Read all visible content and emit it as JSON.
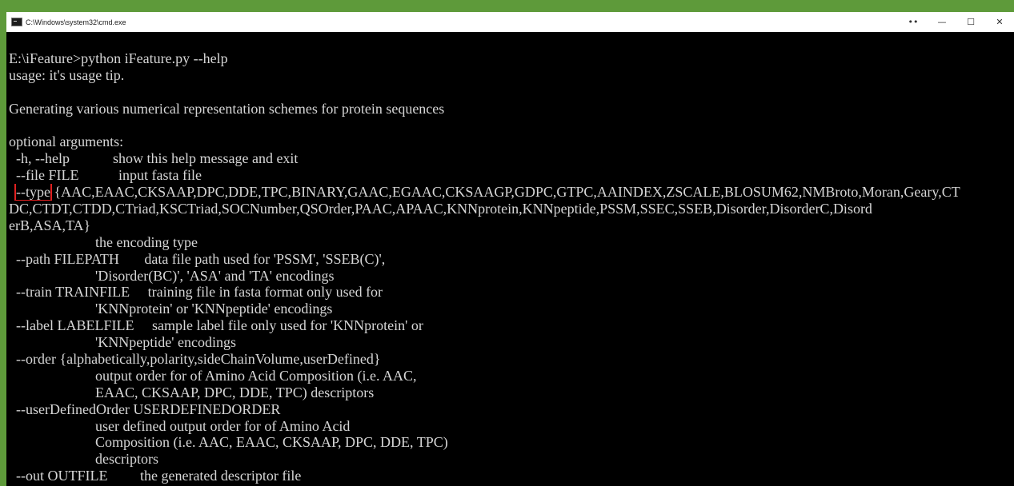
{
  "window": {
    "title": "C:\\Windows\\system32\\cmd.exe",
    "controls": {
      "extra": "••",
      "minimize": "—",
      "maximize": "☐",
      "close": "✕"
    }
  },
  "console": {
    "lines": [
      "E:\\iFeature>python iFeature.py --help",
      "usage: it's usage tip.",
      "",
      "Generating various numerical representation schemes for protein sequences",
      "",
      "optional arguments:",
      "  -h, --help            show this help message and exit",
      "  --file FILE           input fasta file",
      "__TYPE_LINE__",
      "DC,CTDT,CTDD,CTriad,KSCTriad,SOCNumber,QSOrder,PAAC,APAAC,KNNprotein,KNNpeptide,PSSM,SSEC,SSEB,Disorder,DisorderC,Disord",
      "erB,ASA,TA}",
      "                        the encoding type",
      "  --path FILEPATH       data file path used for 'PSSM', 'SSEB(C)',",
      "                        'Disorder(BC)', 'ASA' and 'TA' encodings",
      "  --train TRAINFILE     training file in fasta format only used for",
      "                        'KNNprotein' or 'KNNpeptide' encodings",
      "  --label LABELFILE     sample label file only used for 'KNNprotein' or",
      "                        'KNNpeptide' encodings",
      "  --order {alphabetically,polarity,sideChainVolume,userDefined}",
      "                        output order for of Amino Acid Composition (i.e. AAC,",
      "                        EAAC, CKSAAP, DPC, DDE, TPC) descriptors",
      "  --userDefinedOrder USERDEFINEDORDER",
      "                        user defined output order for of Amino Acid",
      "                        Composition (i.e. AAC, EAAC, CKSAAP, DPC, DDE, TPC)",
      "                        descriptors",
      "  --out OUTFILE         the generated descriptor file"
    ],
    "type_line": {
      "indent": "  ",
      "flag": "--type",
      "rest": " {AAC,EAAC,CKSAAP,DPC,DDE,TPC,BINARY,GAAC,EGAAC,CKSAAGP,GDPC,GTPC,AAINDEX,ZSCALE,BLOSUM62,NMBroto,Moran,Geary,CT"
    }
  },
  "colors": {
    "background": "#5e9a3a",
    "console_bg": "#000000",
    "console_text": "#d6d6d6",
    "highlight": "#e02020"
  }
}
